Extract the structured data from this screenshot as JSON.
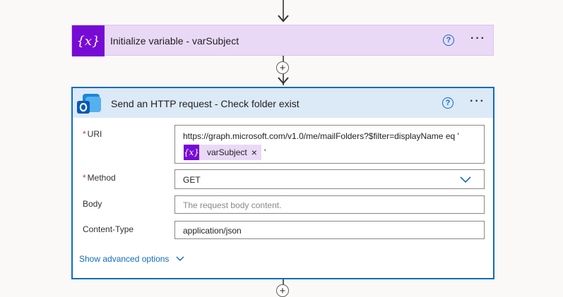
{
  "colors": {
    "accent": "#0f6cbd",
    "variable_purple": "#770bd6",
    "variable_bg": "#ead9f6",
    "http_header_bg": "#dce9f7"
  },
  "variable_action": {
    "icon": "variable-icon",
    "icon_text": "{x}",
    "title": "Initialize variable - varSubject",
    "help_icon_text": "?",
    "more_icon_text": "···"
  },
  "http_action": {
    "icon": "outlook-icon",
    "title": "Send an HTTP request - Check folder exist",
    "help_icon_text": "?",
    "more_icon_text": "···",
    "fields": {
      "uri": {
        "label": "URI",
        "required_mark": "*",
        "value": "https://graph.microsoft.com/v1.0/me/mailFolders?$filter=displayName eq '",
        "token_icon_text": "{x}",
        "token_label": "varSubject",
        "token_remove": "×",
        "trailing": "'"
      },
      "method": {
        "label": "Method",
        "required_mark": "*",
        "value": "GET"
      },
      "body": {
        "label": "Body",
        "placeholder": "The request body content."
      },
      "content_type": {
        "label": "Content-Type",
        "value": "application/json"
      }
    },
    "advanced_link": "Show advanced options"
  },
  "insert_step": {
    "plus": "+"
  }
}
